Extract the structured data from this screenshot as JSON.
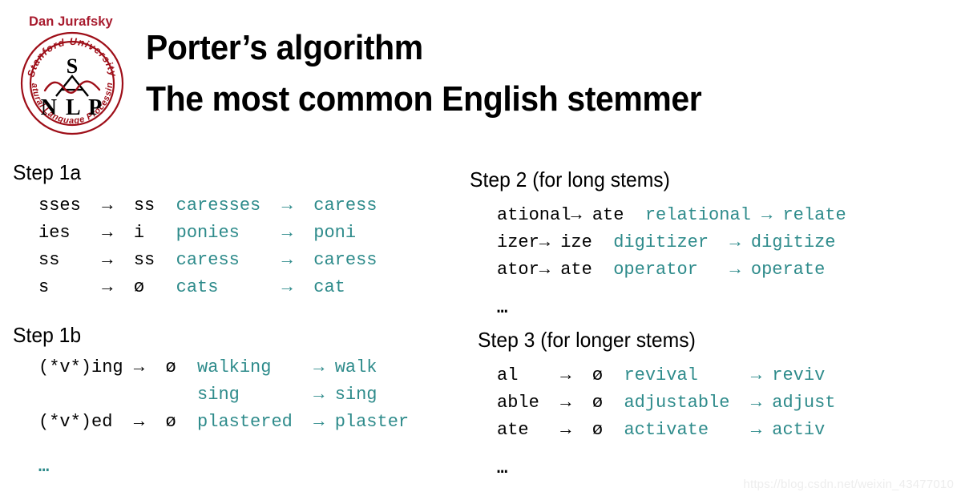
{
  "slide": {
    "author": "Dan Jurafsky",
    "title_line1": "Porter’s algorithm",
    "title_line2": "The most common English stemmer",
    "watermark": "https://blog.csdn.net/weixin_43477010"
  },
  "logo": {
    "top_arc_text": "Stanford University",
    "bottom_arc_text": "Natural Language Processing",
    "letter_top": "S",
    "letters_bottom": "NLP"
  },
  "colors": {
    "author_red": "#A81B2E",
    "logo_red": "#9E0E18",
    "example_teal": "#2E8B8B",
    "rule_black": "#000000",
    "watermark_grey": "#EDEDED"
  },
  "sections": [
    {
      "id": "step-1a",
      "heading": "Step 1a",
      "ellipsis": null,
      "rows": [
        {
          "pattern": "sses",
          "arrow1": "→",
          "result": "ss",
          "example": "caresses",
          "arrow2": "→",
          "stem": "caress"
        },
        {
          "pattern": "ies",
          "arrow1": "→",
          "result": "i",
          "example": "ponies",
          "arrow2": "→",
          "stem": "poni"
        },
        {
          "pattern": "ss",
          "arrow1": "→",
          "result": "ss",
          "example": "caress",
          "arrow2": "→",
          "stem": "caress"
        },
        {
          "pattern": "s",
          "arrow1": "→",
          "result": "ø",
          "example": "cats",
          "arrow2": "→",
          "stem": "cat"
        }
      ]
    },
    {
      "id": "step-1b",
      "heading": "Step 1b",
      "ellipsis": "…",
      "ellipsis_color": "teal",
      "rows": [
        {
          "pattern": "(*v*)ing",
          "arrow1": "→",
          "result": "ø",
          "example": "walking",
          "arrow2": "→",
          "stem": "walk"
        },
        {
          "pattern": "",
          "arrow1": "",
          "result": "",
          "example": "sing",
          "arrow2": "→",
          "stem": "sing"
        },
        {
          "pattern": "(*v*)ed",
          "arrow1": "→",
          "result": "ø",
          "example": "plastered",
          "arrow2": "→",
          "stem": "plaster"
        }
      ]
    },
    {
      "id": "step-2",
      "heading": "Step 2 (for long stems)",
      "ellipsis": "…",
      "ellipsis_color": "black",
      "rows": [
        {
          "pattern": "ational",
          "arrow1": "→",
          "result": "ate",
          "example": "relational",
          "arrow2": "→",
          "stem": "relate"
        },
        {
          "pattern": "izer",
          "arrow1": "→",
          "result": "ize",
          "example": "digitizer",
          "arrow2": "→",
          "stem": "digitize"
        },
        {
          "pattern": "ator",
          "arrow1": "→",
          "result": "ate",
          "example": "operator",
          "arrow2": "→",
          "stem": "operate"
        }
      ]
    },
    {
      "id": "step-3",
      "heading": "Step 3 (for longer stems)",
      "ellipsis": "…",
      "ellipsis_color": "black",
      "rows": [
        {
          "pattern": "al",
          "arrow1": "→",
          "result": "ø",
          "example": "revival",
          "arrow2": "→",
          "stem": "reviv"
        },
        {
          "pattern": "able",
          "arrow1": "→",
          "result": "ø",
          "example": "adjustable",
          "arrow2": "→",
          "stem": "adjust"
        },
        {
          "pattern": "ate",
          "arrow1": "→",
          "result": "ø",
          "example": "activate",
          "arrow2": "→",
          "stem": "activ"
        }
      ]
    }
  ]
}
